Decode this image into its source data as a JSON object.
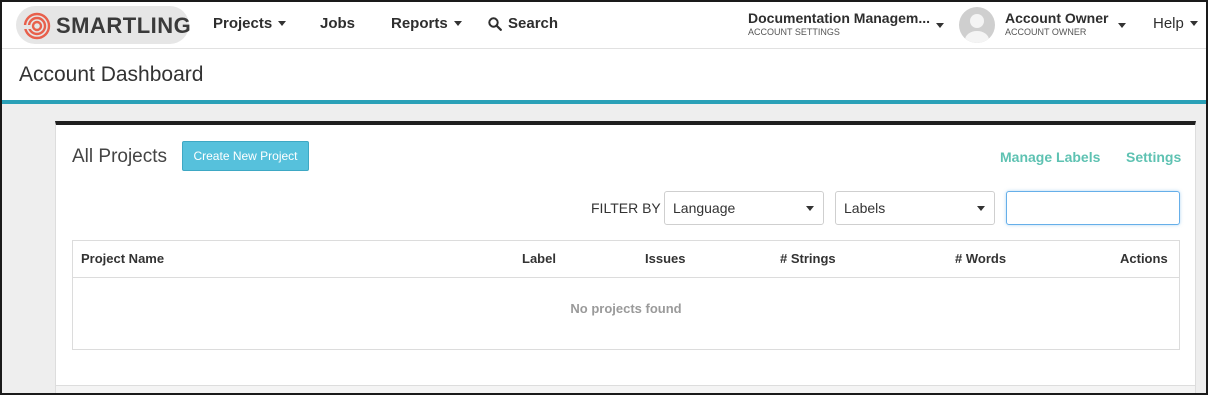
{
  "brand": {
    "name": "SMARTLING",
    "accent": "#e8604c"
  },
  "nav": {
    "projects": "Projects",
    "jobs": "Jobs",
    "reports": "Reports",
    "search": "Search",
    "account_switcher": {
      "title": "Documentation Managem...",
      "subtitle": "ACCOUNT SETTINGS"
    },
    "user": {
      "name": "Account Owner",
      "role": "ACCOUNT OWNER"
    },
    "help": "Help"
  },
  "page": {
    "title": "Account Dashboard",
    "accent_bar": "#2aa0b7"
  },
  "projects_panel": {
    "title": "All Projects",
    "create_button": "Create New Project",
    "manage_labels": "Manage Labels",
    "settings": "Settings",
    "filter_label": "FILTER BY",
    "language_select": "Language",
    "labels_select": "Labels",
    "search_value": "",
    "columns": [
      "Project Name",
      "Label",
      "Issues",
      "# Strings",
      "# Words",
      "Actions"
    ],
    "empty_message": "No projects found",
    "link_color": "#5ec2b2",
    "button_color": "#56c1dc"
  }
}
